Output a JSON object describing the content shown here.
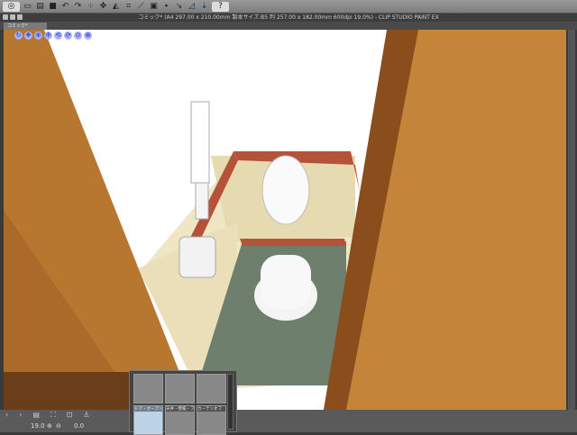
{
  "toolbar": {
    "items": [
      "clip-studio-icon",
      "new-icon",
      "open-icon",
      "save-icon",
      "undo-icon",
      "redo-icon",
      "select-all-icon",
      "transform-icon",
      "fill-icon",
      "crop-icon",
      "ruler-icon",
      "layer-icon",
      "snap-icon",
      "snap-ruler-icon",
      "snap-grid-icon",
      "help-icon"
    ]
  },
  "window": {
    "title": "コミック* (A4 297.00 x 210.00mm 製本サイズ:B5 判 257.00 x 182.00mm 600dpi 19.0%)  - CLIP STUDIO PAINT EX"
  },
  "tab": {
    "label": "コミック*"
  },
  "status": {
    "zoom": "19.0",
    "angle": "0.0"
  },
  "popup": {
    "presets": [
      {
        "label": ""
      },
      {
        "label": ""
      },
      {
        "label": ""
      },
      {
        "label": "ドア・オープン"
      },
      {
        "label": "天井・壁紙・フ"
      },
      {
        "label": "カーテンオフ"
      }
    ]
  },
  "colors": {
    "wood": "#b8772f",
    "tile_floor": "#6f7f6d",
    "wall": "#e8dcb8",
    "trim": "#b5533a"
  }
}
